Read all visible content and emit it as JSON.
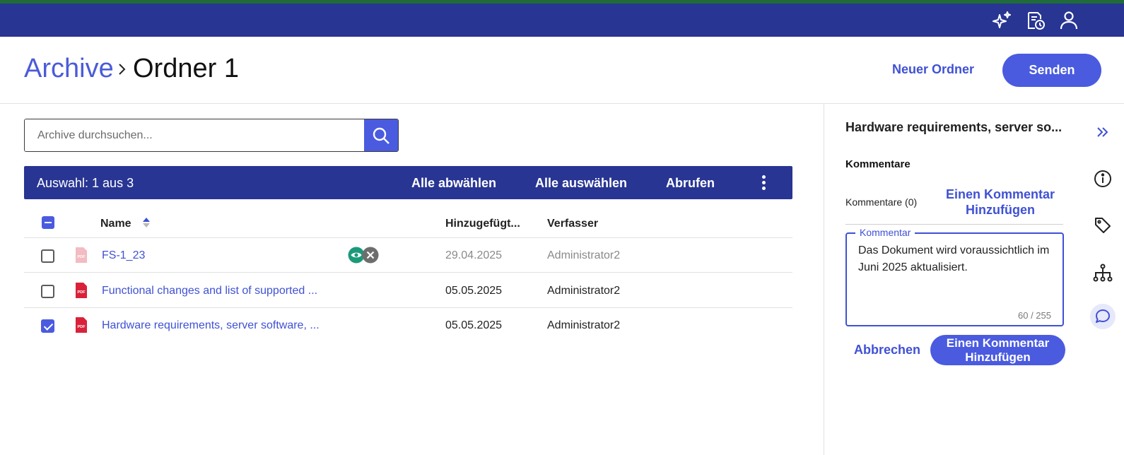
{
  "topbar": {
    "icons": [
      "sparkle-icon",
      "document-clock-icon",
      "user-icon"
    ]
  },
  "header": {
    "breadcrumb_root": "Archive",
    "breadcrumb_current": "Ordner 1",
    "new_folder": "Neuer Ordner",
    "send": "Senden"
  },
  "search": {
    "placeholder": "Archive durchsuchen..."
  },
  "selection_bar": {
    "count": "Auswahl: 1 aus 3",
    "deselect_all": "Alle abwählen",
    "select_all": "Alle auswählen",
    "retrieve": "Abrufen"
  },
  "table": {
    "columns": [
      "Name",
      "Hinzugefügt...",
      "Verfasser"
    ],
    "rows": [
      {
        "name": "FS-1_23",
        "date": "29.04.2025",
        "author": "Administrator2",
        "checked": false
      },
      {
        "name": "Functional changes and list of supported ...",
        "date": "05.05.2025",
        "author": "Administrator2",
        "checked": false
      },
      {
        "name": "Hardware requirements, server software, ...",
        "date": "05.05.2025",
        "author": "Administrator2",
        "checked": true
      }
    ]
  },
  "panel": {
    "title": "Hardware requirements, server so...",
    "section": "Kommentare",
    "count": "Kommentare (0)",
    "add_link_1": "Einen Kommentar",
    "add_link_2": "Hinzufügen",
    "field_label": "Kommentar",
    "comment_text": "Das Dokument wird voraussichtlich im Juni 2025 aktualisiert.",
    "char_count": "60 / 255",
    "cancel": "Abbrechen",
    "submit_1": "Einen Kommentar",
    "submit_2": "Hinzufügen"
  },
  "colors": {
    "nav": "#283593",
    "accent": "#4a5be0",
    "link": "#3f51d4",
    "pdf_red": "#d9223a"
  }
}
